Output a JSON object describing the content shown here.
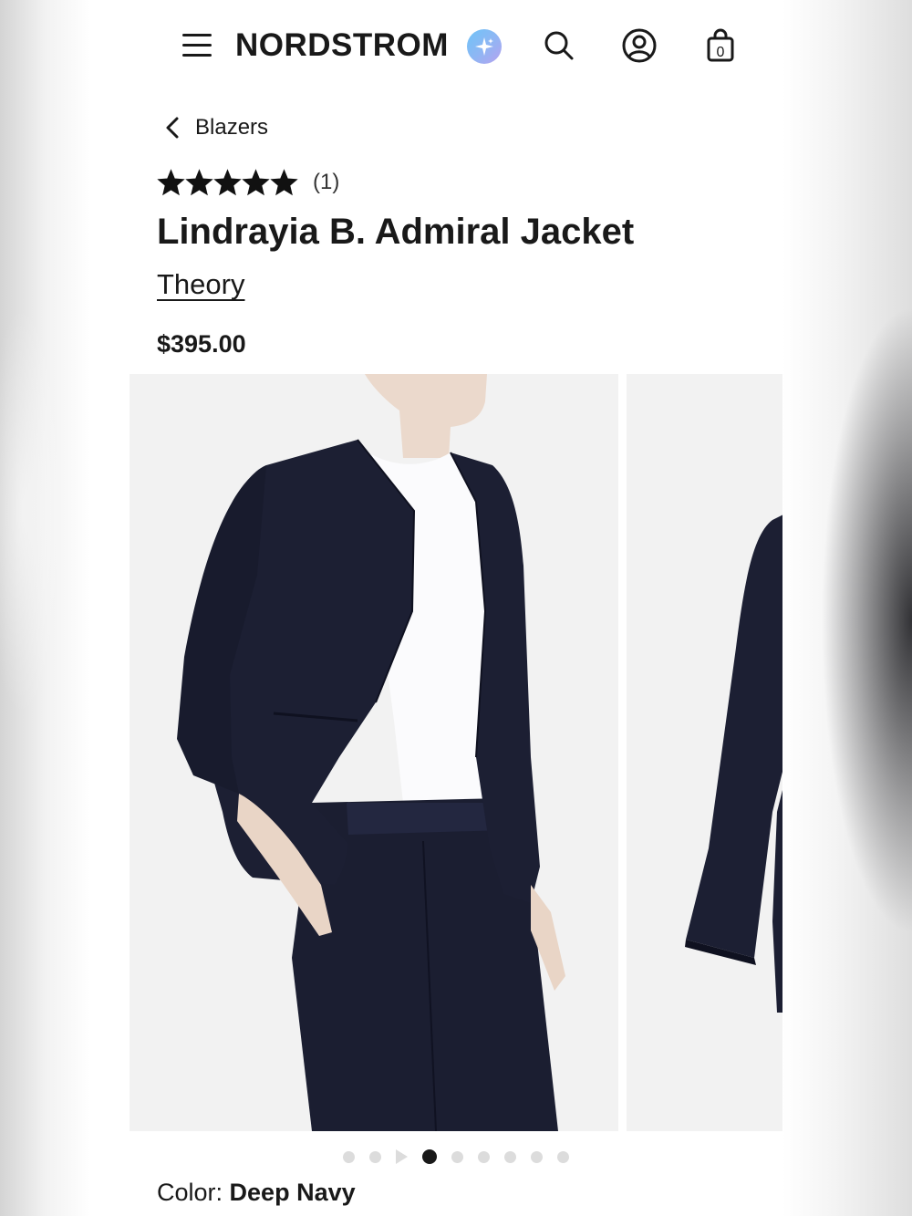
{
  "header": {
    "logo": "NORDSTROM",
    "bag_count": "0"
  },
  "breadcrumb": {
    "label": "Blazers"
  },
  "product": {
    "rating": 5,
    "review_count": "(1)",
    "title": "Lindrayia B. Admiral Jacket",
    "brand": "Theory",
    "price": "$395.00"
  },
  "gallery": {
    "total_dots": 9,
    "active_index": 3,
    "video_index": 2
  },
  "color": {
    "label": "Color:",
    "value": "Deep Navy"
  },
  "colors": {
    "text": "#191919",
    "garment": "#1c1f33",
    "photo_bg": "#f2f2f2"
  }
}
